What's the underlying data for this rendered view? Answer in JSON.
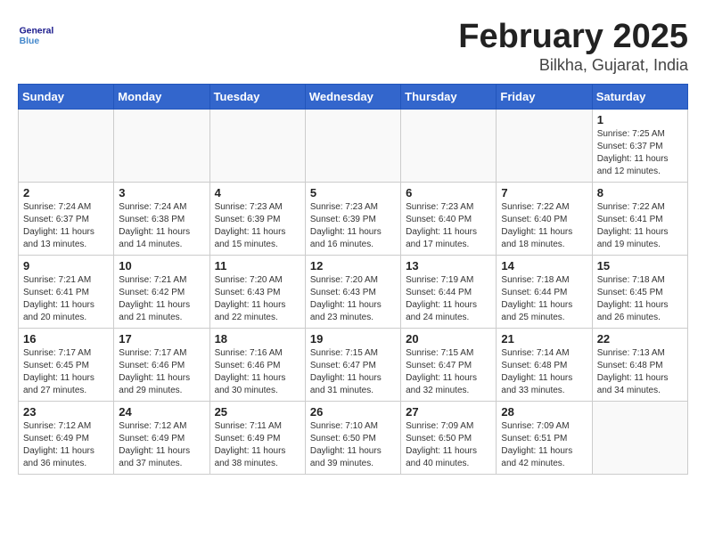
{
  "header": {
    "logo_general": "General",
    "logo_blue": "Blue",
    "title": "February 2025",
    "subtitle": "Bilkha, Gujarat, India"
  },
  "weekdays": [
    "Sunday",
    "Monday",
    "Tuesday",
    "Wednesday",
    "Thursday",
    "Friday",
    "Saturday"
  ],
  "weeks": [
    [
      {
        "day": "",
        "info": ""
      },
      {
        "day": "",
        "info": ""
      },
      {
        "day": "",
        "info": ""
      },
      {
        "day": "",
        "info": ""
      },
      {
        "day": "",
        "info": ""
      },
      {
        "day": "",
        "info": ""
      },
      {
        "day": "1",
        "info": "Sunrise: 7:25 AM\nSunset: 6:37 PM\nDaylight: 11 hours\nand 12 minutes."
      }
    ],
    [
      {
        "day": "2",
        "info": "Sunrise: 7:24 AM\nSunset: 6:37 PM\nDaylight: 11 hours\nand 13 minutes."
      },
      {
        "day": "3",
        "info": "Sunrise: 7:24 AM\nSunset: 6:38 PM\nDaylight: 11 hours\nand 14 minutes."
      },
      {
        "day": "4",
        "info": "Sunrise: 7:23 AM\nSunset: 6:39 PM\nDaylight: 11 hours\nand 15 minutes."
      },
      {
        "day": "5",
        "info": "Sunrise: 7:23 AM\nSunset: 6:39 PM\nDaylight: 11 hours\nand 16 minutes."
      },
      {
        "day": "6",
        "info": "Sunrise: 7:23 AM\nSunset: 6:40 PM\nDaylight: 11 hours\nand 17 minutes."
      },
      {
        "day": "7",
        "info": "Sunrise: 7:22 AM\nSunset: 6:40 PM\nDaylight: 11 hours\nand 18 minutes."
      },
      {
        "day": "8",
        "info": "Sunrise: 7:22 AM\nSunset: 6:41 PM\nDaylight: 11 hours\nand 19 minutes."
      }
    ],
    [
      {
        "day": "9",
        "info": "Sunrise: 7:21 AM\nSunset: 6:41 PM\nDaylight: 11 hours\nand 20 minutes."
      },
      {
        "day": "10",
        "info": "Sunrise: 7:21 AM\nSunset: 6:42 PM\nDaylight: 11 hours\nand 21 minutes."
      },
      {
        "day": "11",
        "info": "Sunrise: 7:20 AM\nSunset: 6:43 PM\nDaylight: 11 hours\nand 22 minutes."
      },
      {
        "day": "12",
        "info": "Sunrise: 7:20 AM\nSunset: 6:43 PM\nDaylight: 11 hours\nand 23 minutes."
      },
      {
        "day": "13",
        "info": "Sunrise: 7:19 AM\nSunset: 6:44 PM\nDaylight: 11 hours\nand 24 minutes."
      },
      {
        "day": "14",
        "info": "Sunrise: 7:18 AM\nSunset: 6:44 PM\nDaylight: 11 hours\nand 25 minutes."
      },
      {
        "day": "15",
        "info": "Sunrise: 7:18 AM\nSunset: 6:45 PM\nDaylight: 11 hours\nand 26 minutes."
      }
    ],
    [
      {
        "day": "16",
        "info": "Sunrise: 7:17 AM\nSunset: 6:45 PM\nDaylight: 11 hours\nand 27 minutes."
      },
      {
        "day": "17",
        "info": "Sunrise: 7:17 AM\nSunset: 6:46 PM\nDaylight: 11 hours\nand 29 minutes."
      },
      {
        "day": "18",
        "info": "Sunrise: 7:16 AM\nSunset: 6:46 PM\nDaylight: 11 hours\nand 30 minutes."
      },
      {
        "day": "19",
        "info": "Sunrise: 7:15 AM\nSunset: 6:47 PM\nDaylight: 11 hours\nand 31 minutes."
      },
      {
        "day": "20",
        "info": "Sunrise: 7:15 AM\nSunset: 6:47 PM\nDaylight: 11 hours\nand 32 minutes."
      },
      {
        "day": "21",
        "info": "Sunrise: 7:14 AM\nSunset: 6:48 PM\nDaylight: 11 hours\nand 33 minutes."
      },
      {
        "day": "22",
        "info": "Sunrise: 7:13 AM\nSunset: 6:48 PM\nDaylight: 11 hours\nand 34 minutes."
      }
    ],
    [
      {
        "day": "23",
        "info": "Sunrise: 7:12 AM\nSunset: 6:49 PM\nDaylight: 11 hours\nand 36 minutes."
      },
      {
        "day": "24",
        "info": "Sunrise: 7:12 AM\nSunset: 6:49 PM\nDaylight: 11 hours\nand 37 minutes."
      },
      {
        "day": "25",
        "info": "Sunrise: 7:11 AM\nSunset: 6:49 PM\nDaylight: 11 hours\nand 38 minutes."
      },
      {
        "day": "26",
        "info": "Sunrise: 7:10 AM\nSunset: 6:50 PM\nDaylight: 11 hours\nand 39 minutes."
      },
      {
        "day": "27",
        "info": "Sunrise: 7:09 AM\nSunset: 6:50 PM\nDaylight: 11 hours\nand 40 minutes."
      },
      {
        "day": "28",
        "info": "Sunrise: 7:09 AM\nSunset: 6:51 PM\nDaylight: 11 hours\nand 42 minutes."
      },
      {
        "day": "",
        "info": ""
      }
    ]
  ]
}
